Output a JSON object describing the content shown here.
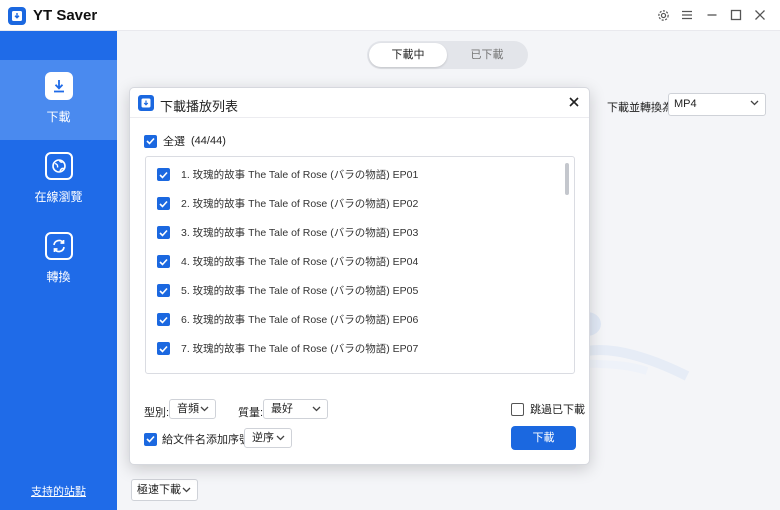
{
  "app": {
    "title": "YT Saver"
  },
  "sidebar": {
    "items": [
      {
        "label": "下載",
        "icon": "download-icon",
        "active": true
      },
      {
        "label": "在線瀏覽",
        "icon": "globe-icon",
        "active": false
      },
      {
        "label": "轉換",
        "icon": "convert-icon",
        "active": false
      }
    ],
    "footer_link": "支持的站點"
  },
  "main": {
    "tabs": [
      {
        "label": "下載中",
        "active": true
      },
      {
        "label": "已下載",
        "active": false
      }
    ],
    "convert_label": "下載並轉換為",
    "convert_format": "MP4",
    "speed_mode": "極速下載"
  },
  "dialog": {
    "title": "下載播放列表",
    "select_all_label": "全選",
    "select_all_count": "(44/44)",
    "items": [
      "1. 玫瑰的故事 The Tale of Rose (バラの物語) EP01",
      "2. 玫瑰的故事 The Tale of Rose (バラの物語) EP02",
      "3. 玫瑰的故事 The Tale of Rose (バラの物語) EP03",
      "4. 玫瑰的故事 The Tale of Rose (バラの物語) EP04",
      "5. 玫瑰的故事 The Tale of Rose (バラの物語) EP05",
      "6. 玫瑰的故事 The Tale of Rose (バラの物語) EP06",
      "7. 玫瑰的故事 The Tale of Rose (バラの物語) EP07"
    ],
    "type_label": "型別:",
    "type_value": "音頻",
    "quality_label": "質量:",
    "quality_value": "最好",
    "skip_label": "跳過已下載",
    "prefix_label": "給文件名添加序號",
    "order_value": "逆序",
    "download_button": "下載"
  },
  "colors": {
    "accent": "#1b68e0",
    "sidebar": "#1f6be8",
    "sidebar_active": "#4a8aef"
  }
}
